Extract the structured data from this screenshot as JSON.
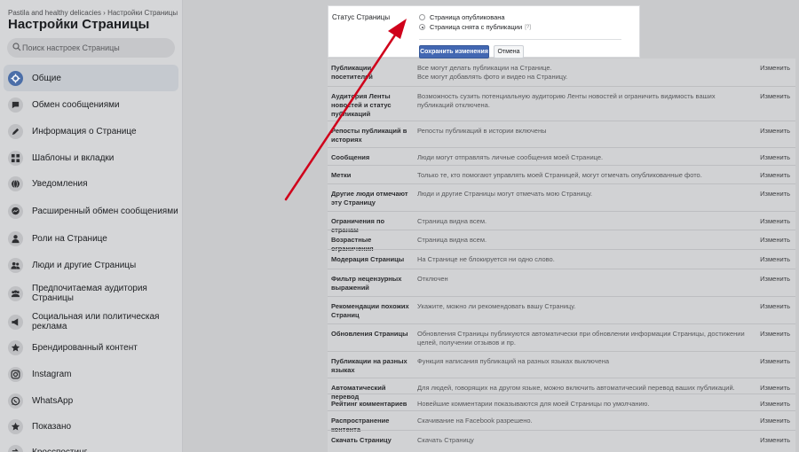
{
  "sidebar": {
    "breadcrumb": "Pastila and healthy delicacies › Настройки Страницы",
    "title": "Настройки Страницы",
    "search_placeholder": "Поиск настроек Страницы",
    "items": [
      {
        "label": "Общие",
        "icon": "gear-icon",
        "active": true
      },
      {
        "label": "Обмен сообщениями",
        "icon": "chat-bubble-icon"
      },
      {
        "label": "Информация о Странице",
        "icon": "pencil-icon"
      },
      {
        "label": "Шаблоны и вкладки",
        "icon": "grid-icon"
      },
      {
        "label": "Уведомления",
        "icon": "globe-icon"
      },
      {
        "label": "Расширенный обмен сообщениями",
        "icon": "messenger-icon"
      },
      {
        "label": "Роли на Странице",
        "icon": "person-icon"
      },
      {
        "label": "Люди и другие Страницы",
        "icon": "people-icon"
      },
      {
        "label": "Предпочитаемая аудитория Страницы",
        "icon": "audience-icon"
      },
      {
        "label": "Социальная или политическая реклама",
        "icon": "megaphone-icon"
      },
      {
        "label": "Брендированный контент",
        "icon": "branded-icon"
      },
      {
        "label": "Instagram",
        "icon": "instagram-icon"
      },
      {
        "label": "WhatsApp",
        "icon": "whatsapp-icon"
      },
      {
        "label": "Показано",
        "icon": "star-icon"
      },
      {
        "label": "Кросспостинг",
        "icon": "crosspost-icon"
      }
    ]
  },
  "status_dialog": {
    "title": "Статус Страницы",
    "option_published": "Страница опубликована",
    "option_unpublished": "Страница снята с публикации",
    "help": "[?]",
    "selected": "unpublished",
    "save_label": "Сохранить изменения",
    "cancel_label": "Отмена"
  },
  "settings": {
    "edit_label": "Изменить",
    "rows": [
      {
        "label": "Публикации посетителей",
        "desc": "Все могут делать публикации на Странице.\nВсе могут добавлять фото и видео на Страницу."
      },
      {
        "label": "Аудитория Ленты новостей и статус публикаций",
        "desc": "Возможность сузить потенциальную аудиторию Ленты новостей и ограничить видимость ваших публикаций отключена."
      },
      {
        "label": "Репосты публикаций в историях",
        "desc": "Репосты публикаций в истории включены"
      },
      {
        "label": "Сообщения",
        "desc": "Люди могут отправлять личные сообщения моей Странице."
      },
      {
        "label": "Метки",
        "desc": "Только те, кто помогают управлять моей Страницей, могут отмечать опубликованные фото."
      },
      {
        "label": "Другие люди отмечают эту Страницу",
        "desc": "Люди и другие Страницы могут отмечать мою Страницу."
      },
      {
        "label": "Ограничения по странам",
        "desc": "Страница видна всем."
      },
      {
        "label": "Возрастные ограничения",
        "desc": "Страница видна всем."
      },
      {
        "label": "Модерация Страницы",
        "desc": "На Странице не блокируется ни одно слово."
      },
      {
        "label": "Фильтр нецензурных выражений",
        "desc": "Отключен"
      },
      {
        "label": "Рекомендации похожих Страниц",
        "desc": "Укажите, можно ли рекомендовать вашу Страницу."
      },
      {
        "label": "Обновления Страницы",
        "desc": "Обновления Страницы публикуются автоматически при обновлении информации Страницы, достижении целей, получении отзывов и пр."
      },
      {
        "label": "Публикации на разных языках",
        "desc": "Функция написания публикаций на разных языках выключена"
      },
      {
        "label": "Автоматический перевод",
        "desc": "Для людей, говорящих на другом языке, можно включить автоматический перевод ваших публикаций."
      },
      {
        "label": "Рейтинг комментариев",
        "desc": "Новейшие комментарии показываются для моей Страницы по умолчанию."
      },
      {
        "label": "Распространение контента",
        "desc": "Скачивание на Facebook разрешено."
      },
      {
        "label": "Скачать Страницу",
        "desc": "Скачать Страницу"
      }
    ]
  },
  "colors": {
    "accent": "#4267b2",
    "arrow": "#d0021b"
  }
}
